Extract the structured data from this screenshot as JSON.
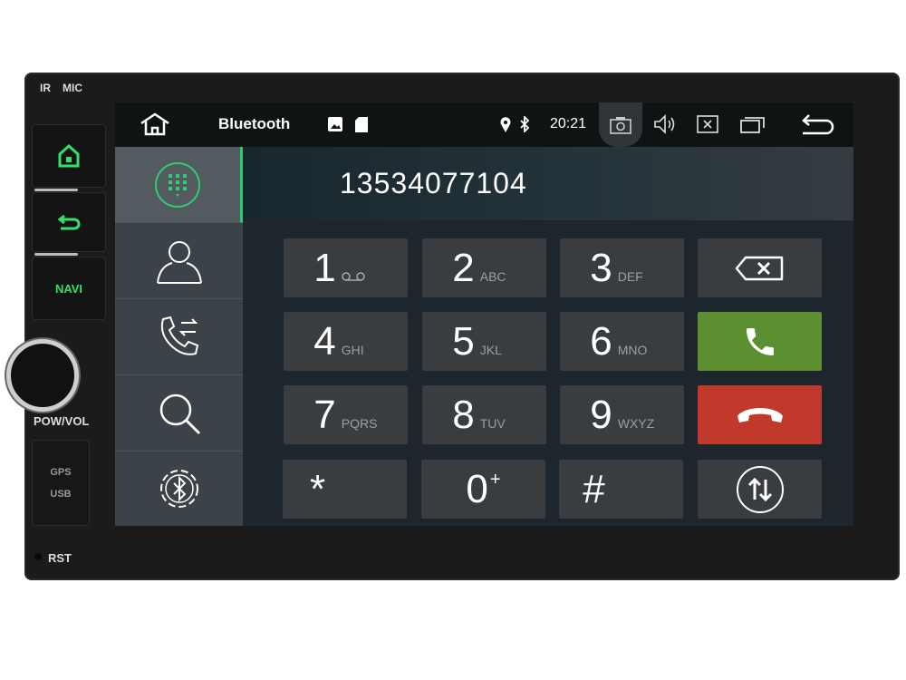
{
  "hardware": {
    "ir": "IR",
    "mic": "MIC",
    "navi": "NAVI",
    "pow_vol": "POW/VOL",
    "gps": "GPS",
    "usb": "USB",
    "rst": "RST",
    "led_color": "#33e06a"
  },
  "status_bar": {
    "app_title": "Bluetooth",
    "time": "20:21",
    "icons": [
      "home-icon",
      "image-icon",
      "sd-card-icon",
      "location-icon",
      "bluetooth-icon",
      "camera-icon",
      "volume-icon",
      "close-window-icon",
      "recent-apps-icon",
      "back-icon"
    ]
  },
  "sidebar": {
    "items": [
      "dialpad",
      "contacts",
      "call-log",
      "search",
      "bluetooth-settings"
    ],
    "active": "dialpad",
    "accent": "#2ecc71"
  },
  "dialer": {
    "number": "13534077104",
    "keys": [
      {
        "digit": "1",
        "sub": "voicemail"
      },
      {
        "digit": "2",
        "sub": "ABC"
      },
      {
        "digit": "3",
        "sub": "DEF"
      },
      {
        "digit": "4",
        "sub": "GHI"
      },
      {
        "digit": "5",
        "sub": "JKL"
      },
      {
        "digit": "6",
        "sub": "MNO"
      },
      {
        "digit": "7",
        "sub": "PQRS"
      },
      {
        "digit": "8",
        "sub": "TUV"
      },
      {
        "digit": "9",
        "sub": "WXYZ"
      },
      {
        "digit": "*",
        "sub": ""
      },
      {
        "digit": "0",
        "sub": "+"
      },
      {
        "digit": "#",
        "sub": ""
      }
    ],
    "call_color": "#5b8f30",
    "hangup_color": "#c0392b"
  }
}
